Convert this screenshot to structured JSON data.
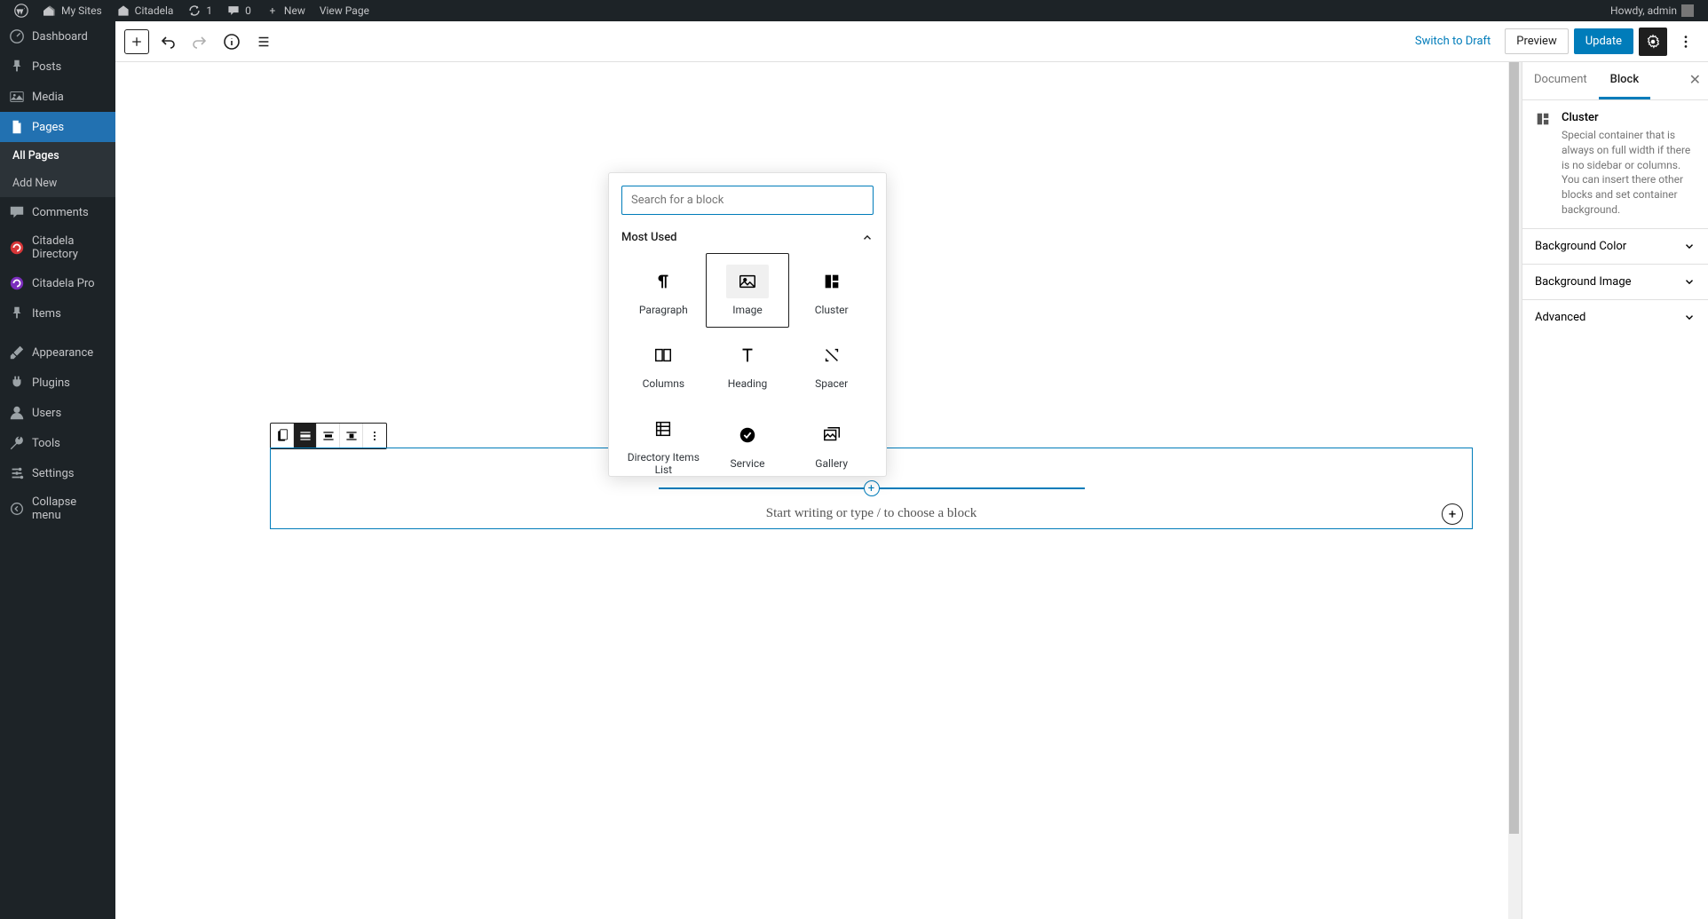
{
  "adminbar": {
    "mysites": "My Sites",
    "site": "Citadela",
    "updates": "1",
    "comments": "0",
    "new": "New",
    "viewpage": "View Page",
    "howdy": "Howdy, admin"
  },
  "sidebar": {
    "items": [
      {
        "label": "Dashboard",
        "icon": "dashboard"
      },
      {
        "label": "Posts",
        "icon": "pin"
      },
      {
        "label": "Media",
        "icon": "media"
      },
      {
        "label": "Pages",
        "icon": "page",
        "current": true
      },
      {
        "label": "Comments",
        "icon": "comment"
      },
      {
        "label": "Citadela Directory",
        "icon": "cdir"
      },
      {
        "label": "Citadela Pro",
        "icon": "cpro"
      },
      {
        "label": "Items",
        "icon": "pin"
      },
      {
        "label": "Appearance",
        "icon": "brush"
      },
      {
        "label": "Plugins",
        "icon": "plug"
      },
      {
        "label": "Users",
        "icon": "user"
      },
      {
        "label": "Tools",
        "icon": "tool"
      },
      {
        "label": "Settings",
        "icon": "settings"
      },
      {
        "label": "Collapse menu",
        "icon": "collapse"
      }
    ],
    "sub": {
      "all": "All Pages",
      "add": "Add New"
    }
  },
  "topbar": {
    "switch": "Switch to Draft",
    "preview": "Preview",
    "update": "Update"
  },
  "rpanel": {
    "tab_doc": "Document",
    "tab_block": "Block",
    "block_name": "Cluster",
    "block_desc": "Special container that is always on full width if there is no sidebar or columns. You can insert there other blocks and set container background.",
    "acc": [
      "Background Color",
      "Background Image",
      "Advanced"
    ]
  },
  "editor": {
    "placeholder": "Start writing or type / to choose a block"
  },
  "inserter": {
    "search_ph": "Search for a block",
    "cat": "Most Used",
    "items": [
      {
        "label": "Paragraph",
        "icon": "para"
      },
      {
        "label": "Image",
        "icon": "image",
        "hover": true
      },
      {
        "label": "Cluster",
        "icon": "cluster"
      },
      {
        "label": "Columns",
        "icon": "columns"
      },
      {
        "label": "Heading",
        "icon": "heading"
      },
      {
        "label": "Spacer",
        "icon": "spacer"
      },
      {
        "label": "Directory Items List",
        "icon": "dirlist"
      },
      {
        "label": "Service",
        "icon": "service"
      },
      {
        "label": "Gallery",
        "icon": "gallery"
      }
    ]
  }
}
